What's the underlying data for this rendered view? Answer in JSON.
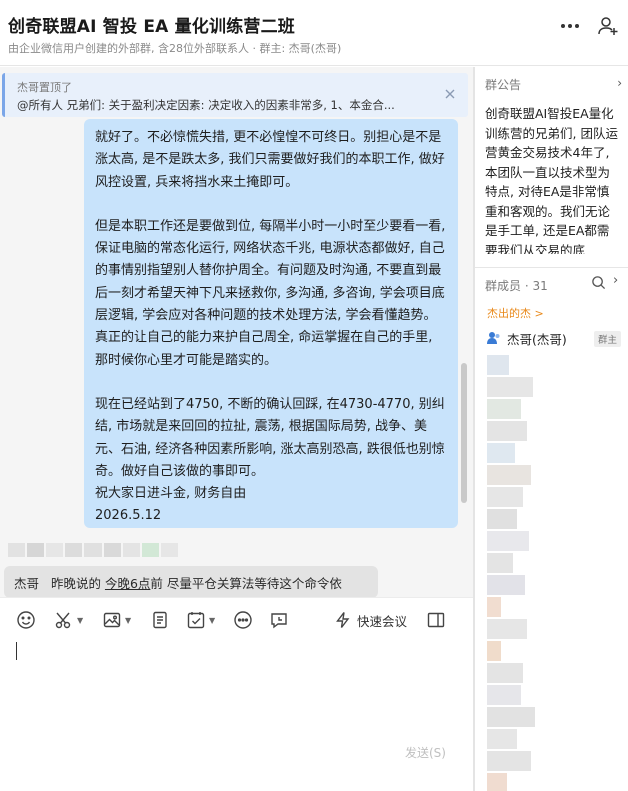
{
  "header": {
    "title": "创奇联盟AI 智投 EA 量化训练营二班",
    "subtitle": "由企业微信用户创建的外部群, 含28位外部联系人 · 群主: 杰哥(杰哥)",
    "more_icon": "more-horizontal-icon",
    "add_member_icon": "add-user-icon"
  },
  "pinned": {
    "title": "杰哥置顶了",
    "text": "@所有人 兄弟们:  关于盈利决定因素: 决定收入的因素非常多, 1、本金合..."
  },
  "message": {
    "paragraphs": [
      "就好了。不必惊慌失措, 更不必惶惶不可终日。别担心是不是涨太高, 是不是跌太多, 我们只需要做好我们的本职工作, 做好风控设置, 兵来将挡水来土掩即可。",
      "",
      "但是本职工作还是要做到位, 每隔半小时一小时至少要看一看, 保证电脑的常态化运行, 网络状态千兆, 电源状态都做好, 自己的事情别指望别人替你护周全。有问题及时沟通, 不要直到最后一刻才希望天神下凡来拯救你, 多沟通, 多咨询, 学会项目底层逻辑, 学会应对各种问题的技术处理方法, 学会看懂趋势。真正的让自己的能力来护自己周全, 命运掌握在自己的手里, 那时候你心里才可能是踏实的。",
      "",
      "现在已经站到了4750, 不断的确认回踩, 在4730-4770, 别纠结, 市场就是来回回的拉扯, 震荡, 根据国际局势, 战争、美元、石油, 经济各种因素所影响, 涨太高别恐高, 跌很低也别惊奇。做好自己该做的事即可。",
      "祝大家日进斗金, 财务自由",
      "2026.5.12"
    ]
  },
  "quote": {
    "author": "杰哥",
    "before": "昨晚说的",
    "link": "今晚6点",
    "after": "前  尽量平仓关算法等待这个命令依"
  },
  "toolbar": {
    "quick_meeting_label": "快速会议",
    "send_label": "发送(S)"
  },
  "announcement": {
    "header": "群公告",
    "text": "创奇联盟AI智投EA量化训练营的兄弟们, 团队运营黄金交易技术4年了, 本团队一直以技术型为特点, 对待EA是非常慎重和客观的。我们无论是手工单, 还是EA都需要我们从交易的底"
  },
  "members": {
    "header": "群成员 · 31",
    "group_label": "杰出的杰 >",
    "owner_name": "杰哥(杰哥)",
    "owner_badge": "群主"
  },
  "colors": {
    "bubble": "#c8e3fb",
    "chat_bg": "#f5f5f5",
    "pinned_bg": "#e8f0fb",
    "accent_orange": "#e98a1c"
  }
}
